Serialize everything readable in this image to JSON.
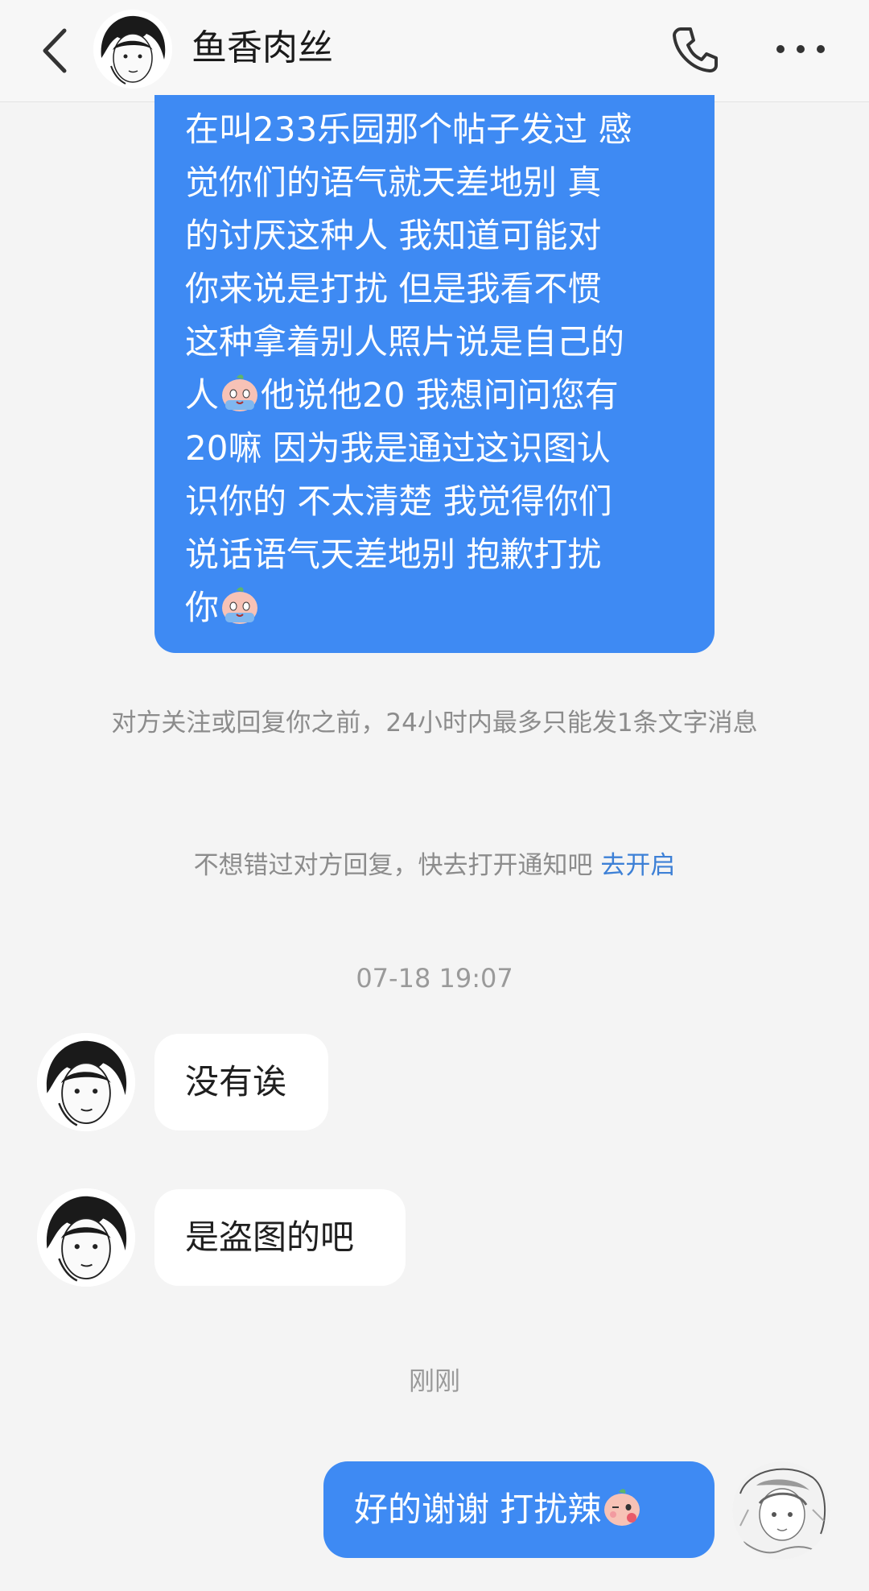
{
  "header": {
    "title": "鱼香肉丝",
    "back_icon": "chevron-left-icon",
    "call_icon": "phone-icon",
    "more_icon": "more-dots-icon"
  },
  "messages": {
    "long_message_lines": [
      "在叫233乐园那个帖子发过 感",
      "觉你们的语气就天差地别 真",
      "的讨厌这种人 我知道可能对",
      "你来说是打扰 但是我看不惯",
      "这种拿着别人照片说是自己的",
      "人",
      "他说他20 我想问问您有",
      "20嘛 因为我是通过这识图认",
      "识你的 不太清楚 我觉得你们",
      "说话语气天差地别 抱歉打扰",
      "你"
    ],
    "reply_1": "没有诶",
    "reply_2": "是盗图的吧",
    "my_reply": "好的谢谢 打扰辣"
  },
  "system": {
    "limit_notice": "对方关注或回复你之前，24小时内最多只能发1条文字消息",
    "notify_prompt": "不想错过对方回复，快去打开通知吧",
    "notify_link": "去开启"
  },
  "timestamps": {
    "t1": "07-18 19:07",
    "t2": "刚刚"
  },
  "colors": {
    "bubble_out": "#3e8af3",
    "link": "#3d80d6"
  }
}
